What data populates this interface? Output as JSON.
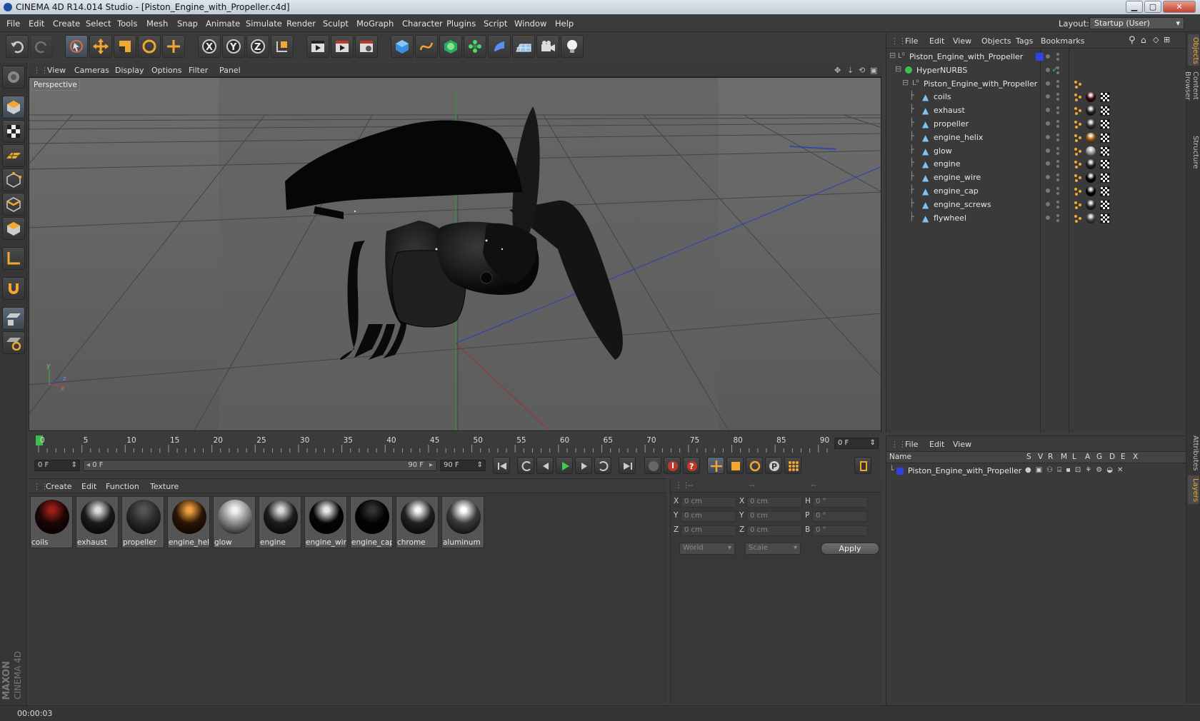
{
  "window": {
    "title": "CINEMA 4D R14.014 Studio - [Piston_Engine_with_Propeller.c4d]",
    "min": "▁",
    "max": "▢",
    "close": "✕"
  },
  "menu": [
    "File",
    "Edit",
    "Create",
    "Select",
    "Tools",
    "Mesh",
    "Snap",
    "Animate",
    "Simulate",
    "Render",
    "Sculpt",
    "MoGraph",
    "Character",
    "Plugins",
    "Script",
    "Window",
    "Help"
  ],
  "layout": {
    "label": "Layout:",
    "value": "Startup (User)"
  },
  "viewport": {
    "menu": [
      "View",
      "Cameras",
      "Display",
      "Options",
      "Filter",
      "Panel"
    ],
    "label": "Perspective"
  },
  "timeline": {
    "ticks": [
      "0",
      "5",
      "10",
      "15",
      "20",
      "25",
      "30",
      "35",
      "40",
      "45",
      "50",
      "55",
      "60",
      "65",
      "70",
      "75",
      "80",
      "85",
      "90"
    ],
    "current_frame": "0 F",
    "start": "0 F",
    "range_start": "0 F",
    "range_end": "90 F",
    "end": "90 F"
  },
  "materials": {
    "menu": [
      "Create",
      "Edit",
      "Function",
      "Texture"
    ],
    "items": [
      {
        "name": "coils",
        "base": "#1a0606",
        "hi": "#a01e16"
      },
      {
        "name": "exhaust",
        "base": "#1c1a18",
        "hi": "#dcdcdc"
      },
      {
        "name": "propeller",
        "base": "#2a2a2a",
        "hi": "#555555"
      },
      {
        "name": "engine_hel",
        "base": "#2a1605",
        "hi": "#f0a040"
      },
      {
        "name": "glow",
        "base": "#8c8c8c",
        "hi": "#f2f2f2"
      },
      {
        "name": "engine",
        "base": "#1c1c1c",
        "hi": "#d8d8d8"
      },
      {
        "name": "engine_wir",
        "base": "#050505",
        "hi": "#e8e8e8"
      },
      {
        "name": "engine_cap",
        "base": "#030303",
        "hi": "#333333"
      },
      {
        "name": "chrome",
        "base": "#202020",
        "hi": "#f6f6f6"
      },
      {
        "name": "aluminum",
        "base": "#3a3a3a",
        "hi": "#ffffff"
      }
    ]
  },
  "coords": {
    "headers": [
      "--",
      "--",
      "--"
    ],
    "rows": [
      {
        "a": "X",
        "v1": "0 cm",
        "b": "X",
        "v2": "0 cm",
        "c": "H",
        "v3": "0 °"
      },
      {
        "a": "Y",
        "v1": "0 cm",
        "b": "Y",
        "v2": "0 cm",
        "c": "P",
        "v3": "0 °"
      },
      {
        "a": "Z",
        "v1": "0 cm",
        "b": "Z",
        "v2": "0 cm",
        "c": "B",
        "v3": "0 °"
      }
    ],
    "mode": "World",
    "mode2": "Scale",
    "apply": "Apply"
  },
  "objects": {
    "menu": [
      "File",
      "Edit",
      "View",
      "Objects",
      "Tags",
      "Bookmarks"
    ],
    "tree": [
      {
        "name": "Piston_Engine_with_Propeller",
        "level": 0,
        "kind": "null"
      },
      {
        "name": "HyperNURBS",
        "level": 1,
        "kind": "nurbs"
      },
      {
        "name": "Piston_Engine_with_Propeller",
        "level": 2,
        "kind": "null"
      },
      {
        "name": "coils",
        "level": 3,
        "kind": "poly",
        "tag": "#3a0808"
      },
      {
        "name": "exhaust",
        "level": 3,
        "kind": "poly",
        "tag": "#222"
      },
      {
        "name": "propeller",
        "level": 3,
        "kind": "poly",
        "tag": "#333"
      },
      {
        "name": "engine_helix",
        "level": 3,
        "kind": "poly",
        "tag": "#a05a10"
      },
      {
        "name": "glow",
        "level": 3,
        "kind": "poly",
        "tag": "#999"
      },
      {
        "name": "engine",
        "level": 3,
        "kind": "poly",
        "tag": "#222"
      },
      {
        "name": "engine_wire",
        "level": 3,
        "kind": "poly",
        "tag": "#050505"
      },
      {
        "name": "engine_cap",
        "level": 3,
        "kind": "poly",
        "tag": "#030303"
      },
      {
        "name": "engine_screws",
        "level": 3,
        "kind": "poly",
        "tag": "#2a2a2a"
      },
      {
        "name": "flywheel",
        "level": 3,
        "kind": "poly",
        "tag": "#444"
      }
    ]
  },
  "layers": {
    "menu": [
      "File",
      "Edit",
      "View"
    ],
    "columns": [
      "Name",
      "S",
      "V",
      "R",
      "M",
      "L",
      "A",
      "G",
      "D",
      "E",
      "X"
    ],
    "row": "Piston_Engine_with_Propeller"
  },
  "sidetabs": [
    "Objects",
    "Content Browser",
    "Structure",
    "Attributes",
    "Layers"
  ],
  "status": "00:00:03",
  "brand": {
    "line1": "MAXON",
    "line2": "CINEMA 4D"
  }
}
